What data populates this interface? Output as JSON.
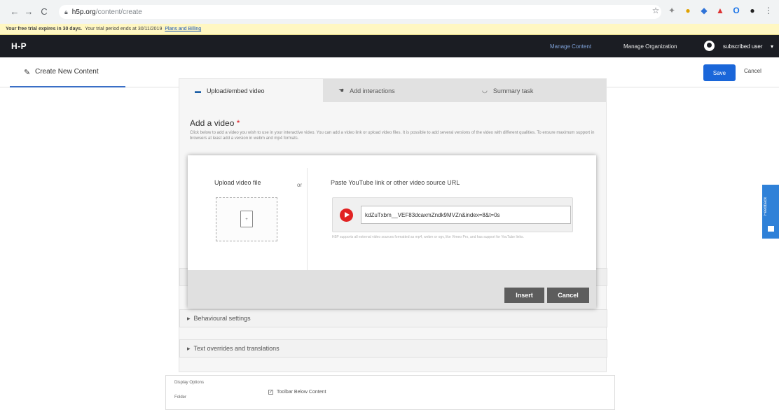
{
  "browser": {
    "url_host": "h5p.org",
    "url_path": "/content/create",
    "nav": [
      "←",
      "→",
      "C"
    ]
  },
  "trial": {
    "bold": "Your free trial expires in 30 days.",
    "text": "Your trial period ends at 30/11/2019",
    "link": "Plans and Billing"
  },
  "topnav": {
    "brand": "H-P",
    "manage_content": "Manage Content",
    "manage_org": "Manage Organization",
    "user": "subscribed user"
  },
  "subheader": {
    "title": "Create New Content",
    "save": "Save",
    "cancel": "Cancel"
  },
  "editor": {
    "tabs": [
      {
        "label": "Upload/embed video",
        "icon": "video"
      },
      {
        "label": "Add interactions",
        "icon": "hand"
      },
      {
        "label": "Summary task",
        "icon": "summary"
      }
    ],
    "heading": "Add a video",
    "required_mark": "*",
    "help": "Click below to add a video you wish to use in your interactive video. You can add a video link or upload video files. It is possible to add several versions of the video with different qualities. To ensure maximum support in browsers at least add a version in webm and mp4 formats.",
    "behavioural": "Behavioural settings",
    "text_overrides": "Text overrides and translations"
  },
  "dialog": {
    "upload_label": "Upload video file",
    "or": "or",
    "paste_label": "Paste YouTube link or other video source URL",
    "url_value": "kdZuTxbm__VEF83dcaxmZndk9MVZn&index=8&t=0s",
    "note": "H5P supports all external video sources formatted as mp4, webm or ogv, like Vimeo Pro, and has support for YouTube links.",
    "insert": "Insert",
    "cancel": "Cancel"
  },
  "display_options": {
    "label": "Display Options",
    "folder": "Folder",
    "toolbar": "Toolbar Below Content"
  },
  "feedback": {
    "label": "Feedback"
  }
}
